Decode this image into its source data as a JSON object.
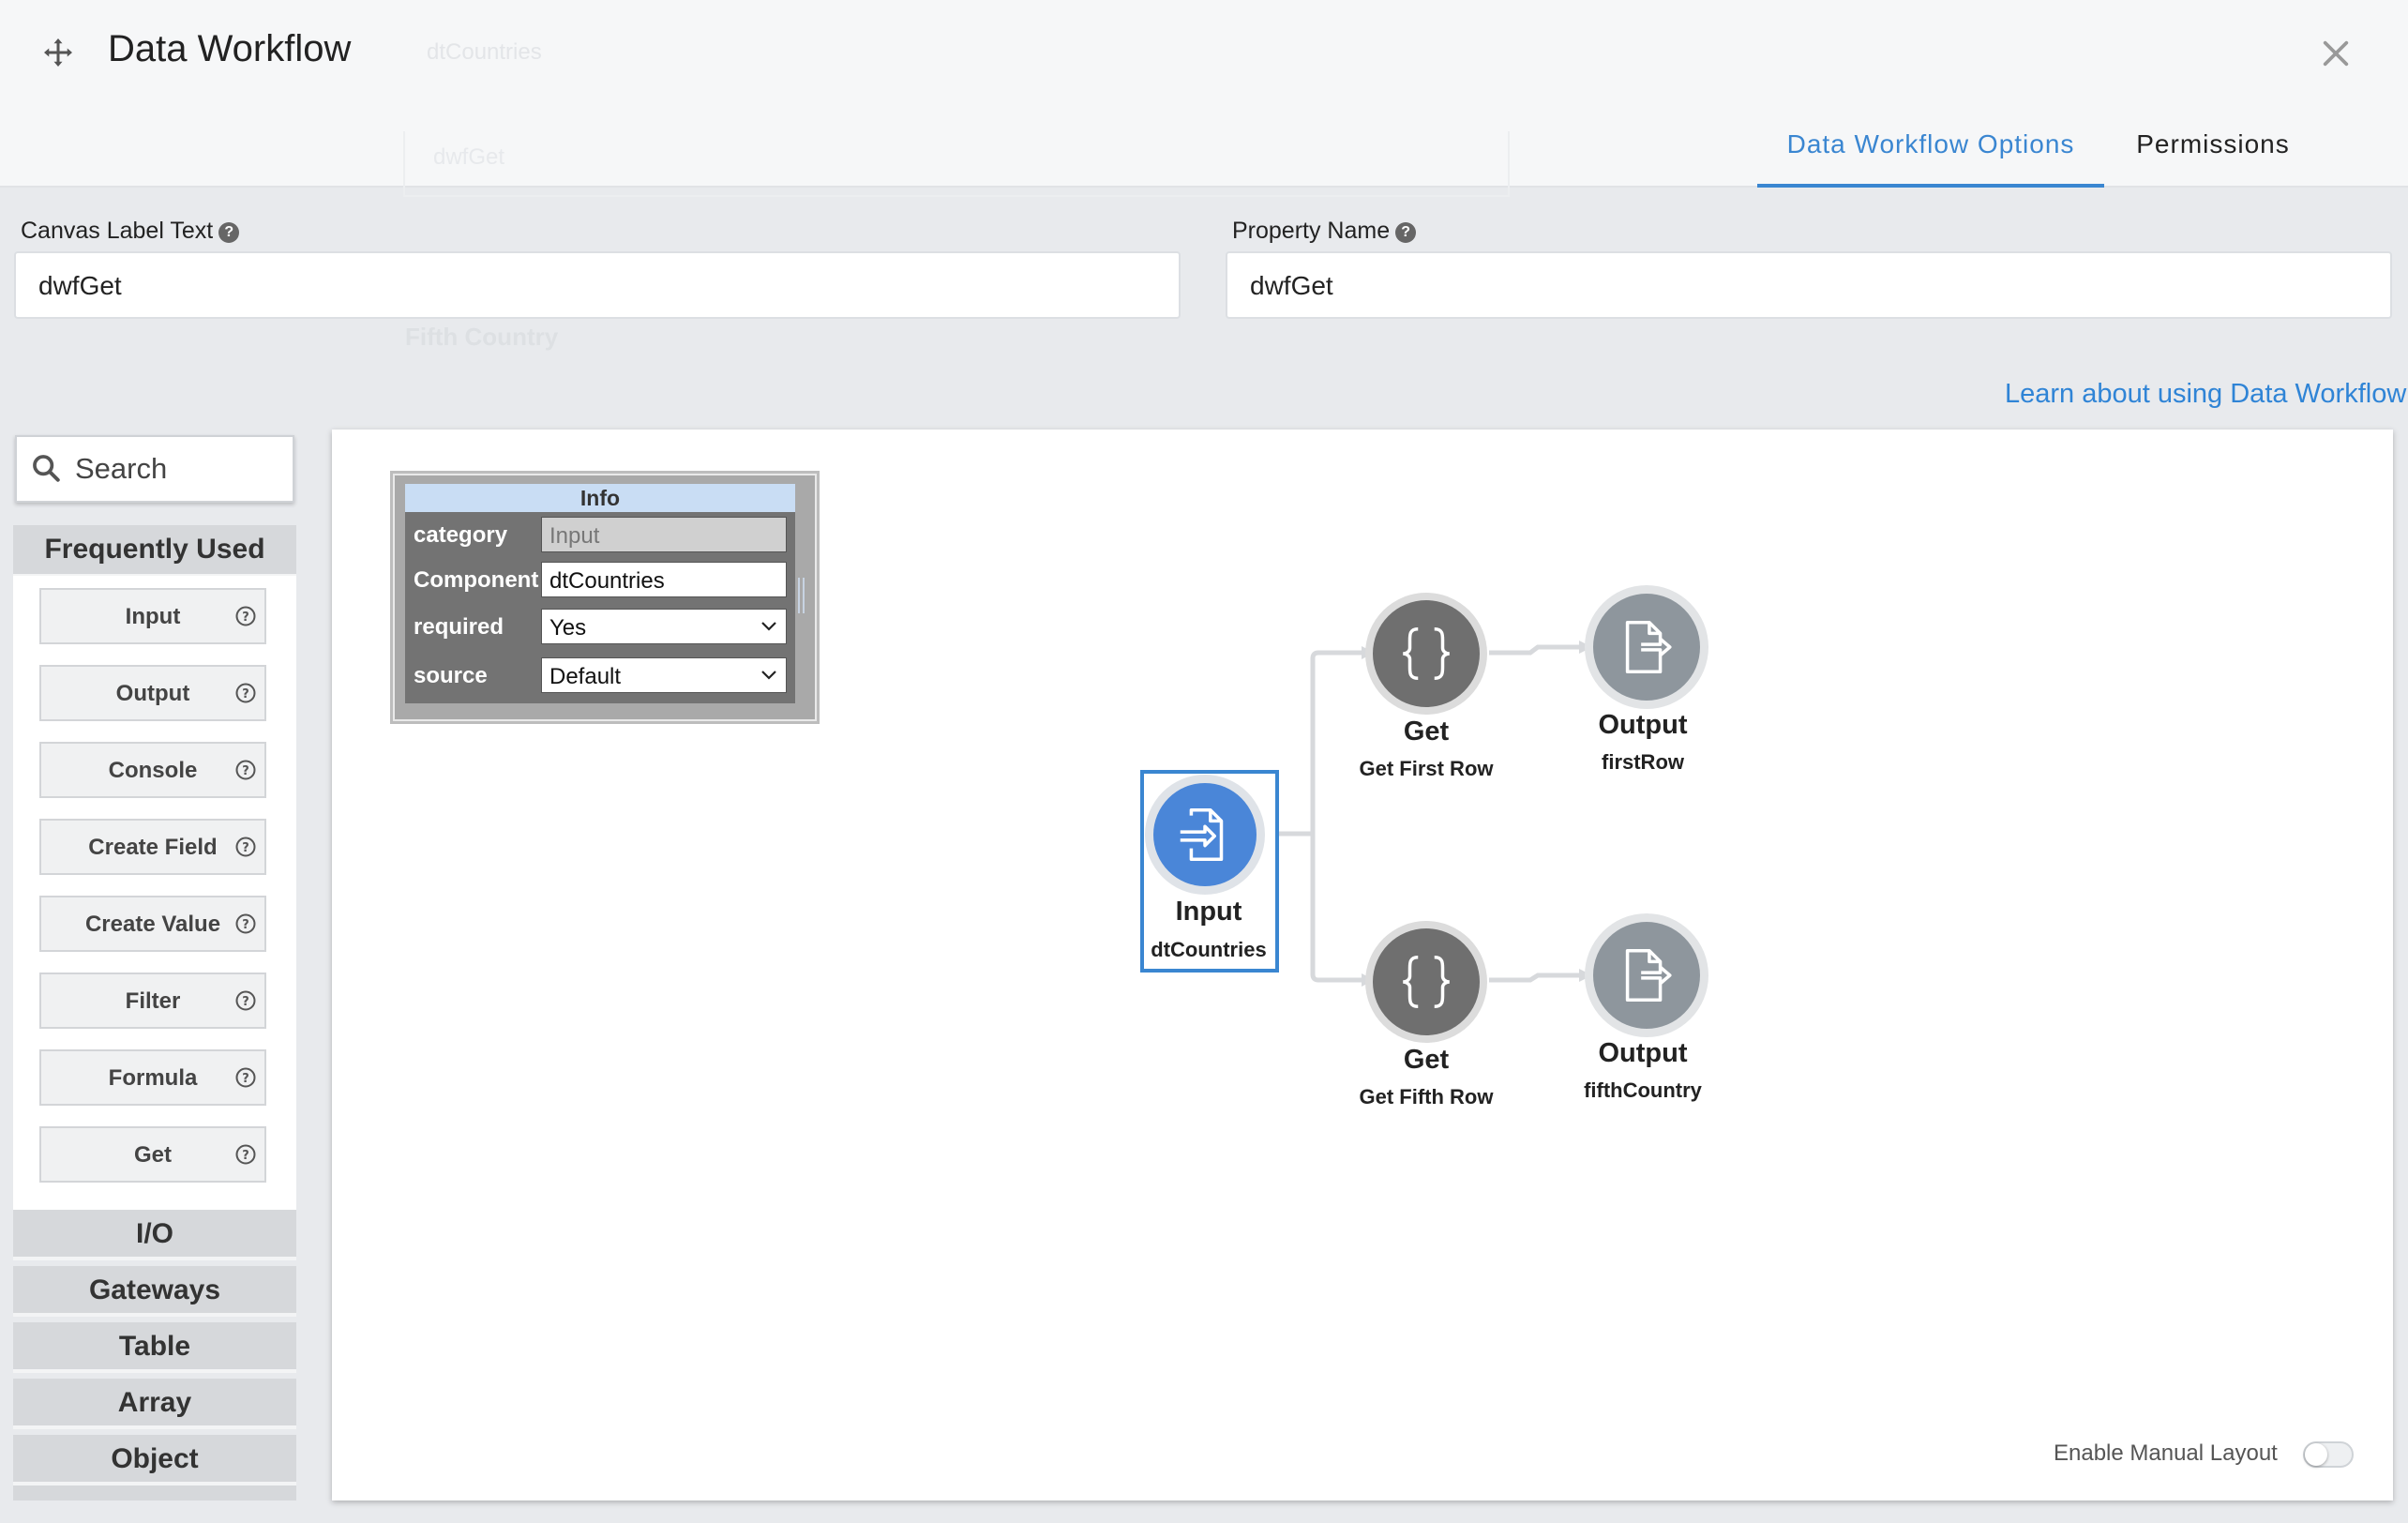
{
  "header": {
    "title": "Data Workflow",
    "ghost_title": "dtCountries",
    "ghost_field": "dwfGet",
    "tabs": [
      {
        "label": "Data Workflow Options"
      },
      {
        "label": "Permissions"
      }
    ]
  },
  "fields": {
    "canvas_label": {
      "label": "Canvas Label Text",
      "value": "dwfGet"
    },
    "property_name": {
      "label": "Property Name",
      "value": "dwfGet"
    }
  },
  "ghost_country": "Fifth Country",
  "learn_link": "Learn about using Data Workflow",
  "sidebar": {
    "search_placeholder": "Search",
    "frequently_used": "Frequently Used",
    "items": [
      {
        "label": "Input"
      },
      {
        "label": "Output"
      },
      {
        "label": "Console"
      },
      {
        "label": "Create Field"
      },
      {
        "label": "Create Value"
      },
      {
        "label": "Filter"
      },
      {
        "label": "Formula"
      },
      {
        "label": "Get"
      }
    ],
    "categories": [
      {
        "label": "I/O"
      },
      {
        "label": "Gateways"
      },
      {
        "label": "Table"
      },
      {
        "label": "Array"
      },
      {
        "label": "Object"
      }
    ]
  },
  "info_panel": {
    "title": "Info",
    "rows": [
      {
        "label": "category",
        "value": "Input"
      },
      {
        "label": "Component",
        "value": "dtCountries"
      },
      {
        "label": "required",
        "value": "Yes"
      },
      {
        "label": "source",
        "value": "Default"
      }
    ]
  },
  "nodes": {
    "input": {
      "title": "Input",
      "subtitle": "dtCountries"
    },
    "get1": {
      "title": "Get",
      "subtitle": "Get First Row"
    },
    "out1": {
      "title": "Output",
      "subtitle": "firstRow"
    },
    "get2": {
      "title": "Get",
      "subtitle": "Get Fifth Row"
    },
    "out2": {
      "title": "Output",
      "subtitle": "fifthCountry"
    }
  },
  "manual_layout": {
    "label": "Enable Manual Layout",
    "enabled": false
  },
  "colors": {
    "accent": "#3a86d1",
    "get_node": "#6f6f6f",
    "output_node": "#8e969d",
    "input_node": "#4a86d8"
  }
}
